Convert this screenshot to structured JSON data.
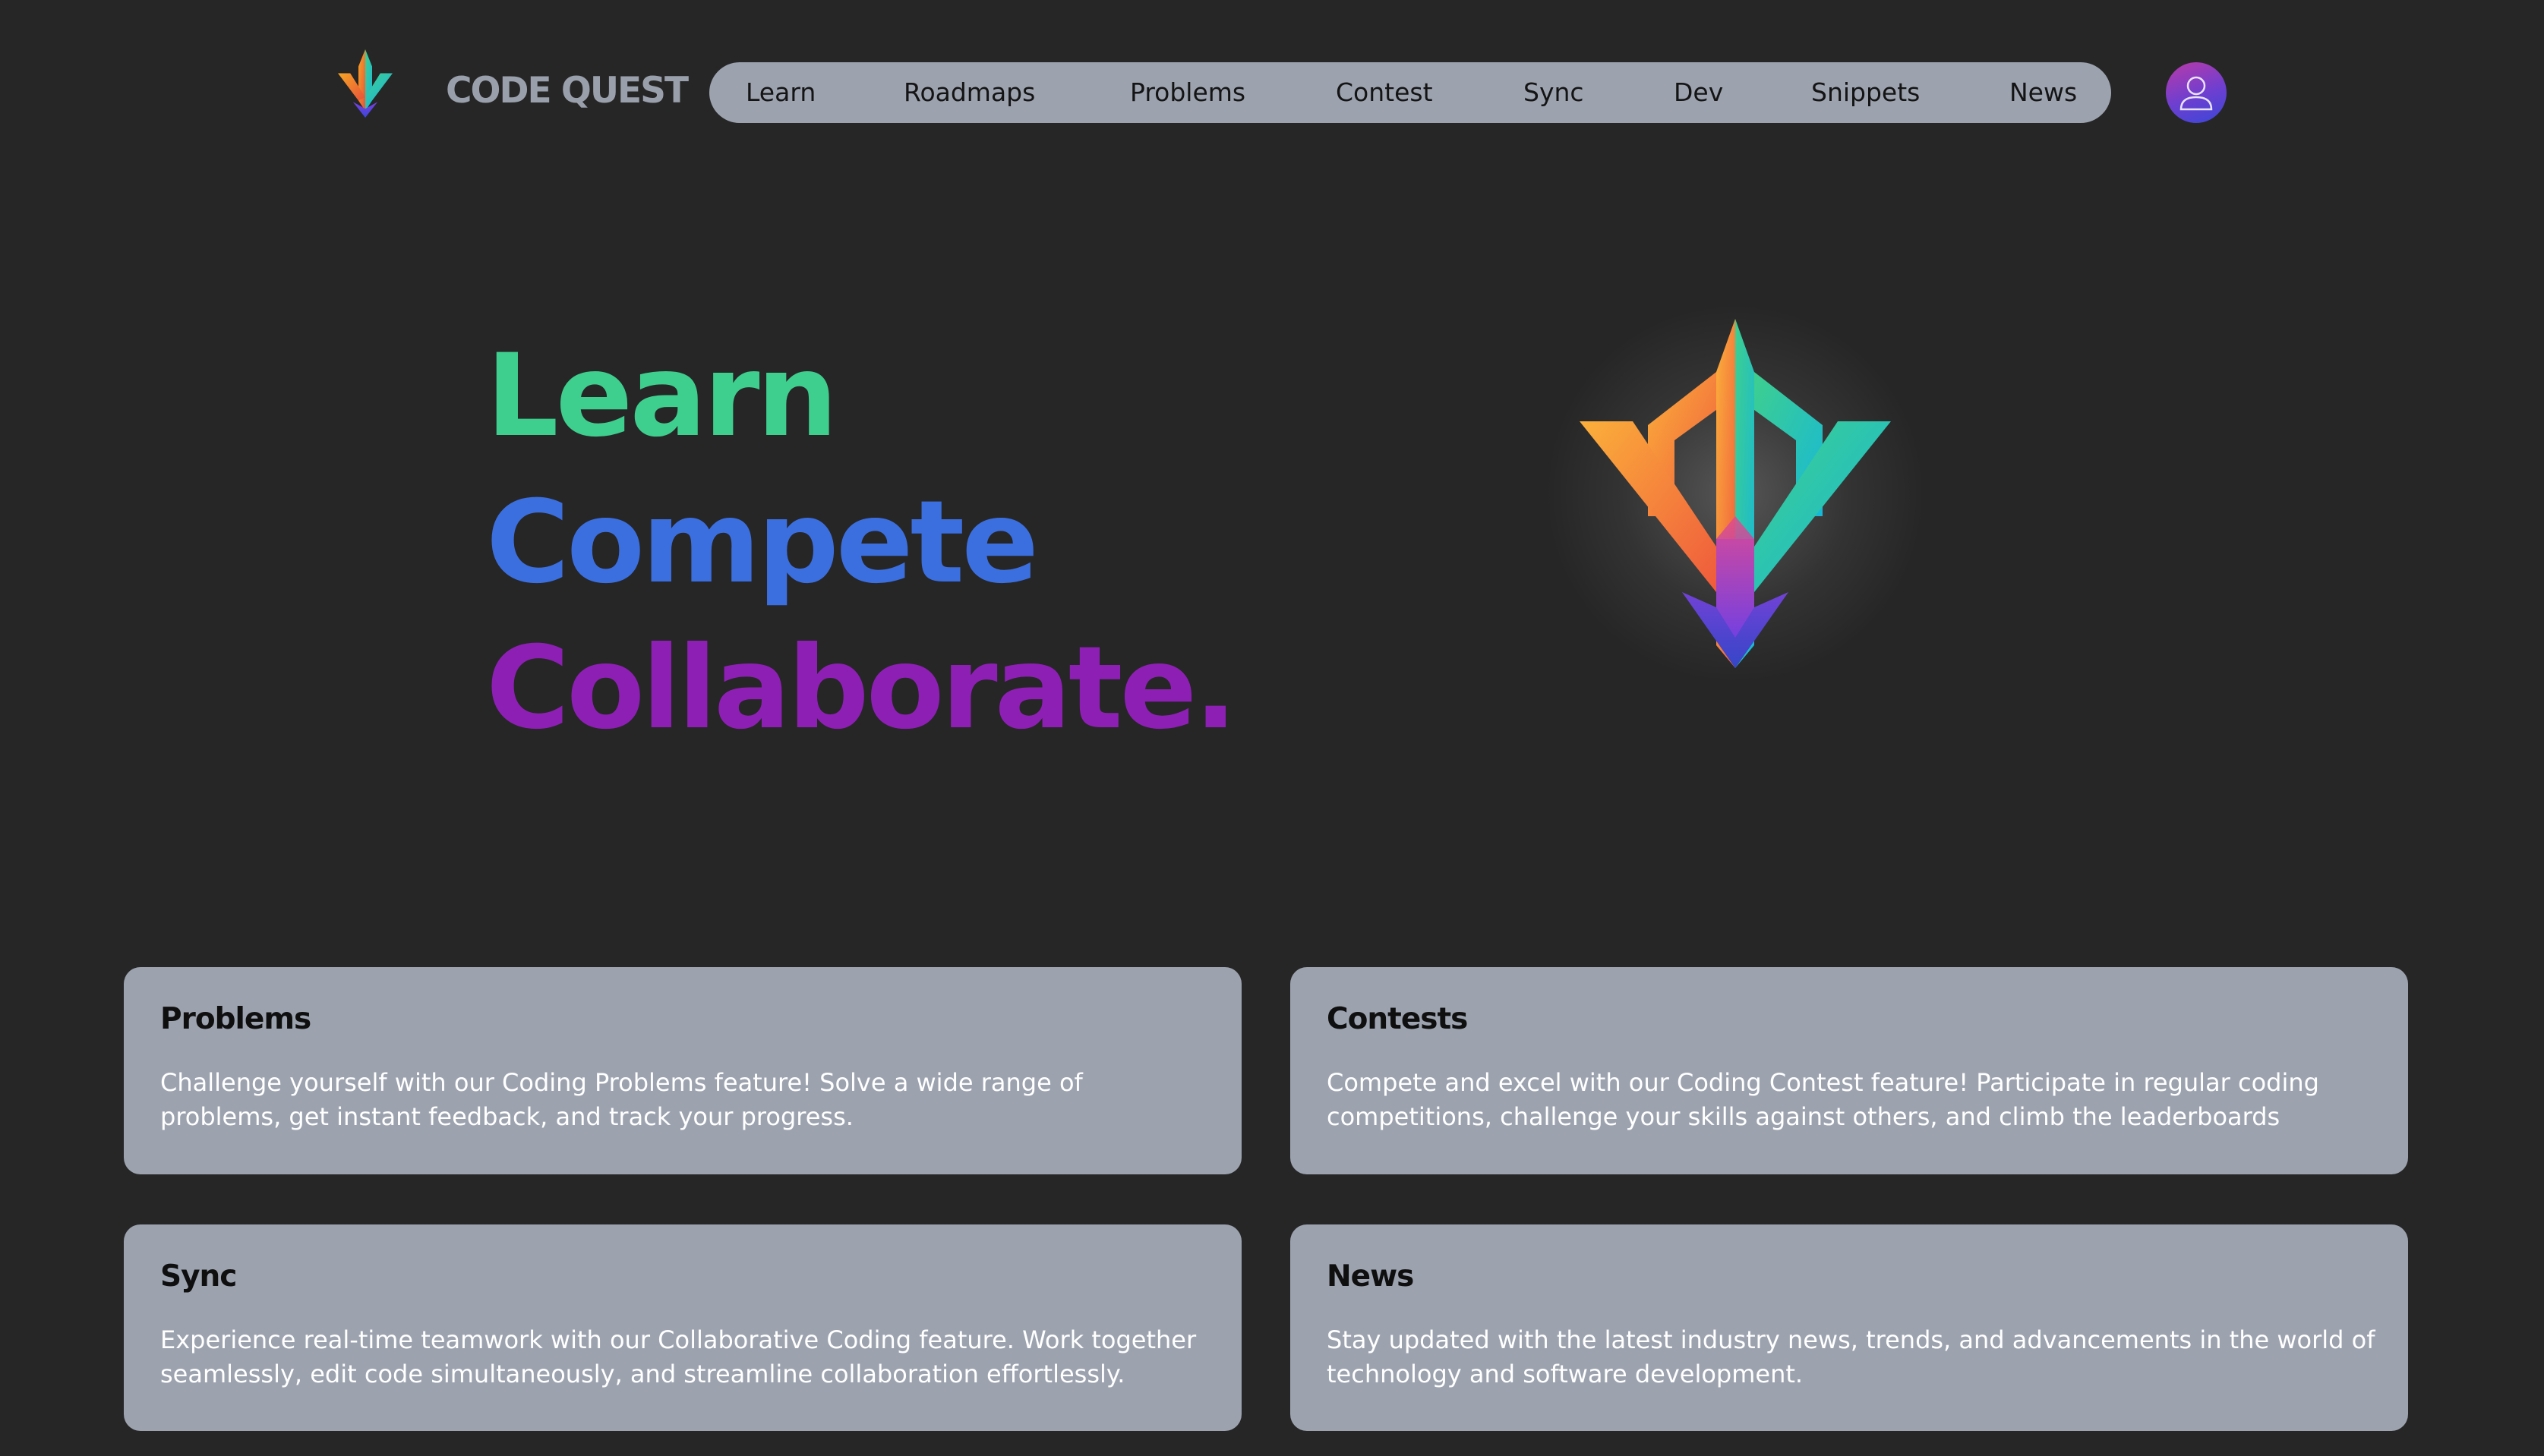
{
  "brand": {
    "name": "CODE QUEST",
    "logo_icon": "code-quest-logo-icon"
  },
  "nav": {
    "items": [
      {
        "label": "Learn"
      },
      {
        "label": "Roadmaps"
      },
      {
        "label": "Problems"
      },
      {
        "label": "Contest"
      },
      {
        "label": "Sync"
      },
      {
        "label": "Dev"
      },
      {
        "label": "Snippets"
      },
      {
        "label": "News"
      }
    ]
  },
  "profile": {
    "icon": "user-avatar-icon"
  },
  "hero": {
    "line1": "Learn",
    "line2": "Compete",
    "line3": "Collaborate.",
    "colors": {
      "learn": "#3ecf8e",
      "compete": "#3b6fe0",
      "collaborate": "#8e1fb5"
    }
  },
  "features": [
    {
      "title": "Problems",
      "description": "Challenge yourself with our Coding Problems feature! Solve a wide range of problems, get instant feedback, and track your progress."
    },
    {
      "title": "Contests",
      "description": "Compete and excel with our Coding Contest feature! Participate in regular coding competitions, challenge your skills against others, and climb the leaderboards"
    },
    {
      "title": "Sync",
      "description": "Experience real-time teamwork with our Collaborative Coding feature. Work together seamlessly, edit code simultaneously, and streamline collaboration effortlessly."
    },
    {
      "title": "News",
      "description": "Stay updated with the latest industry news, trends, and advancements in the world of technology and software development."
    }
  ]
}
